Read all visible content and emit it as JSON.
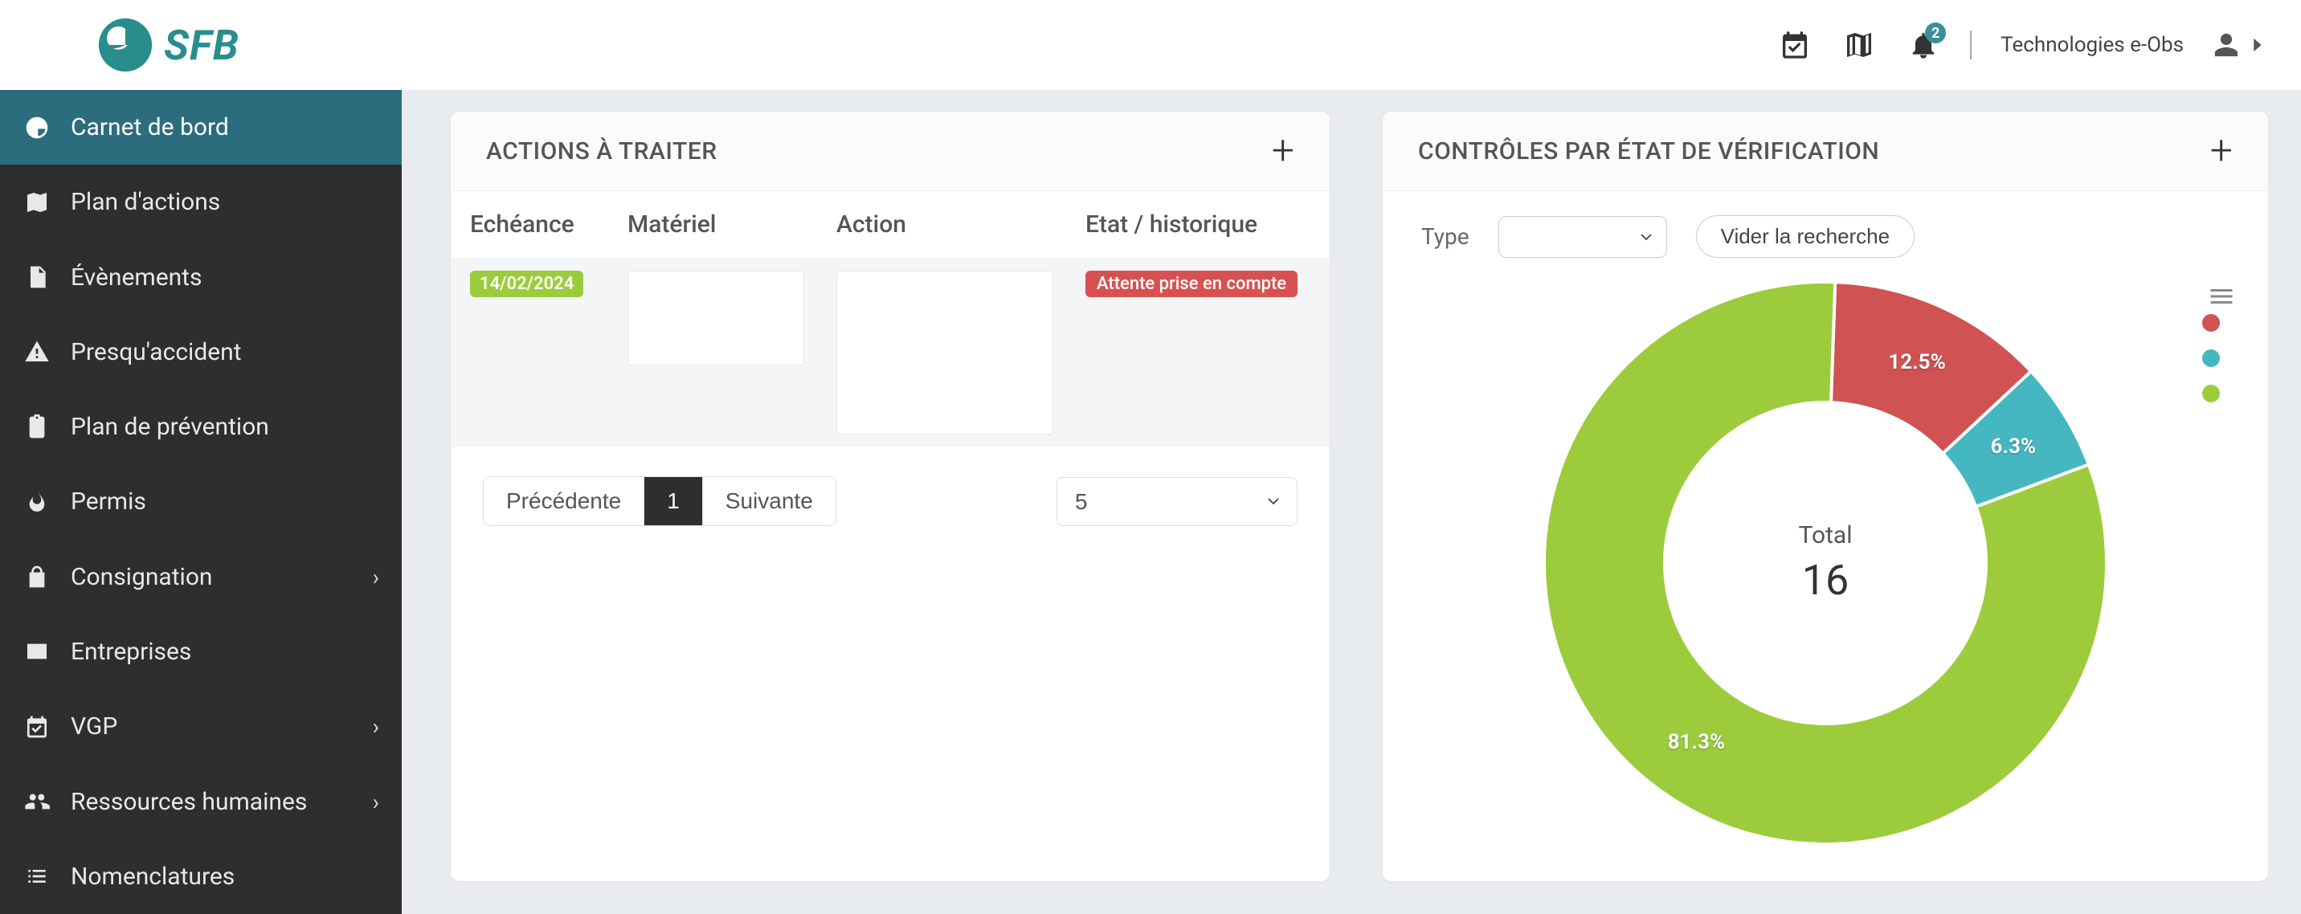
{
  "colors": {
    "red": "#d05252",
    "teal": "#45b7c1",
    "green": "#9ccc3c"
  },
  "topbar": {
    "org": "Technologies e-Obs",
    "notification_count": "2"
  },
  "sidebar": {
    "items": [
      {
        "label": "Carnet de bord"
      },
      {
        "label": "Plan d'actions"
      },
      {
        "label": "Évènements"
      },
      {
        "label": "Presqu'accident"
      },
      {
        "label": "Plan de prévention"
      },
      {
        "label": "Permis"
      },
      {
        "label": "Consignation"
      },
      {
        "label": "Entreprises"
      },
      {
        "label": "VGP"
      },
      {
        "label": "Ressources humaines"
      },
      {
        "label": "Nomenclatures"
      }
    ]
  },
  "actions_card": {
    "title": "ACTIONS À TRAITER",
    "columns": {
      "echeance": "Echéance",
      "materiel": "Matériel",
      "action": "Action",
      "etat": "Etat / historique"
    },
    "rows": [
      {
        "echeance": "14/02/2024",
        "materiel": "",
        "action": "",
        "etat": "Attente prise en compte"
      }
    ],
    "pager": {
      "prev": "Précédente",
      "current": "1",
      "next": "Suivante"
    },
    "page_size": "5"
  },
  "controls_card": {
    "title": "CONTRÔLES PAR ÉTAT DE VÉRIFICATION",
    "type_label": "Type",
    "clear_label": "Vider la recherche",
    "center_label": "Total",
    "center_value": "16"
  },
  "chart_data": {
    "type": "pie",
    "title": "CONTRÔLES PAR ÉTAT DE VÉRIFICATION",
    "total_label": "Total",
    "total": 16,
    "series": [
      {
        "name": "red",
        "value": 2,
        "pct": 12.5,
        "color": "#d05252"
      },
      {
        "name": "teal",
        "value": 1,
        "pct": 6.3,
        "color": "#45b7c1"
      },
      {
        "name": "green",
        "value": 13,
        "pct": 81.3,
        "color": "#9ccc3c"
      }
    ]
  }
}
